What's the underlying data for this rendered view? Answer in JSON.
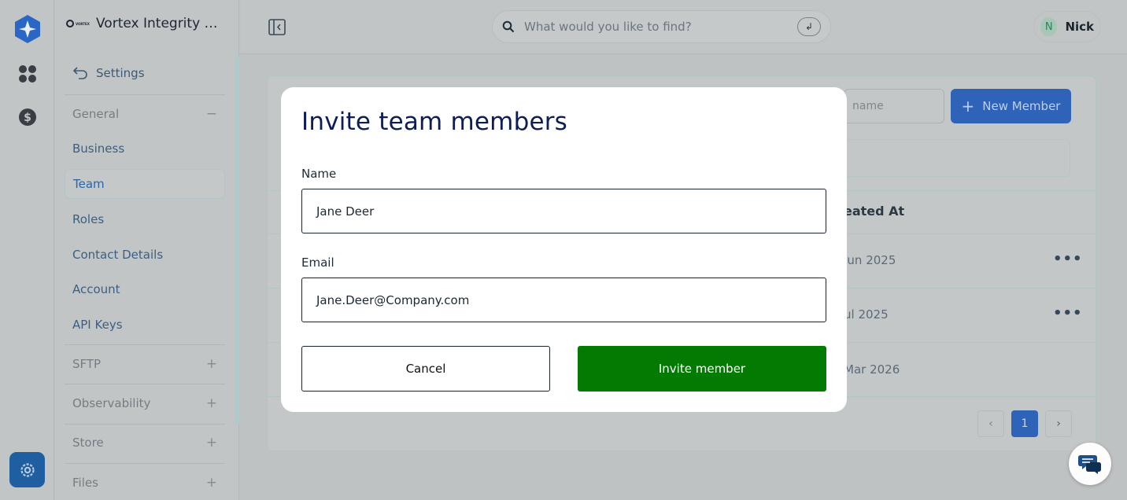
{
  "colors": {
    "accent": "#2f63b8",
    "invite_button": "#037b03",
    "modal_title": "#0e1d55"
  },
  "rail": {
    "icons": [
      "app-logo-icon",
      "apps-grid-icon",
      "billing-dollar-icon",
      "settings-gear-icon"
    ]
  },
  "sidebar": {
    "brand_title": "Vortex Integrity S...",
    "brand_mark_text": "VORTEX",
    "back_label": "Settings",
    "groups": [
      {
        "label": "General",
        "sign": "−"
      },
      {
        "label": "SFTP",
        "sign": "+"
      },
      {
        "label": "Observability",
        "sign": "+"
      },
      {
        "label": "Store",
        "sign": "+"
      },
      {
        "label": "Files",
        "sign": "+"
      }
    ],
    "items": [
      {
        "label": "Business"
      },
      {
        "label": "Team",
        "active": true
      },
      {
        "label": "Roles"
      },
      {
        "label": "Contact Details"
      },
      {
        "label": "Account"
      },
      {
        "label": "API Keys"
      }
    ]
  },
  "topbar": {
    "search_placeholder": "What would you like to find?",
    "enter_glyph": "↲",
    "user_initial": "N",
    "user_name": "Nick"
  },
  "main": {
    "search_name_placeholder": "name",
    "new_member_label": "New Member",
    "new_member_plus": "+",
    "column_header_partial": "eated At",
    "rows": [
      {
        "date_partial": "Jun 2025",
        "menu": "•••"
      },
      {
        "date_partial": "ul 2025",
        "menu": "•••"
      },
      {
        "date_partial": "Mar 2026",
        "menu": ""
      }
    ],
    "pagination": {
      "prev": "‹",
      "current": "1",
      "next": "›"
    }
  },
  "modal": {
    "title": "Invite team members",
    "name_label": "Name",
    "name_value": "Jane Deer",
    "email_label": "Email",
    "email_value": "Jane.Deer@Company.com",
    "cancel_label": "Cancel",
    "invite_label": "Invite member"
  }
}
